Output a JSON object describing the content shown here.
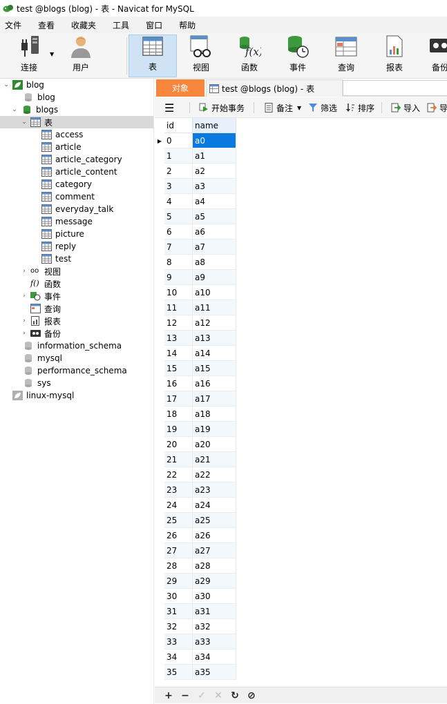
{
  "window": {
    "title": "test @blogs (blog) - 表 - Navicat for MySQL"
  },
  "menubar": {
    "items": [
      "文件",
      "查看",
      "收藏夹",
      "工具",
      "窗口",
      "帮助"
    ]
  },
  "toolbar": {
    "connect": "连接",
    "user": "用户",
    "table": "表",
    "view": "视图",
    "function": "函数",
    "event": "事件",
    "query": "查询",
    "report": "报表",
    "backup": "备份"
  },
  "tree": {
    "conn_blog": "blog",
    "db_blog": "blog",
    "db_blogs": "blogs",
    "node_tables": "表",
    "tables": [
      "access",
      "article",
      "article_category",
      "article_content",
      "category",
      "comment",
      "everyday_talk",
      "message",
      "picture",
      "reply",
      "test"
    ],
    "node_views": "视图",
    "node_functions": "函数",
    "node_events": "事件",
    "node_queries": "查询",
    "node_reports": "报表",
    "node_backups": "备份",
    "db_info": "information_schema",
    "db_mysql": "mysql",
    "db_perf": "performance_schema",
    "db_sys": "sys",
    "conn_linux": "linux-mysql"
  },
  "tabs": {
    "objects": "对象",
    "doc": "test @blogs (blog) - 表"
  },
  "subtoolbar": {
    "begin_transaction": "开始事务",
    "memo": "备注",
    "filter": "筛选",
    "sort": "排序",
    "import": "导入",
    "export": "导"
  },
  "grid": {
    "columns": [
      "id",
      "name"
    ],
    "rows": [
      [
        "0",
        "a0"
      ],
      [
        "1",
        "a1"
      ],
      [
        "2",
        "a2"
      ],
      [
        "3",
        "a3"
      ],
      [
        "4",
        "a4"
      ],
      [
        "5",
        "a5"
      ],
      [
        "6",
        "a6"
      ],
      [
        "7",
        "a7"
      ],
      [
        "8",
        "a8"
      ],
      [
        "9",
        "a9"
      ],
      [
        "10",
        "a10"
      ],
      [
        "11",
        "a11"
      ],
      [
        "12",
        "a12"
      ],
      [
        "13",
        "a13"
      ],
      [
        "14",
        "a14"
      ],
      [
        "15",
        "a15"
      ],
      [
        "16",
        "a16"
      ],
      [
        "17",
        "a17"
      ],
      [
        "18",
        "a18"
      ],
      [
        "19",
        "a19"
      ],
      [
        "20",
        "a20"
      ],
      [
        "21",
        "a21"
      ],
      [
        "22",
        "a22"
      ],
      [
        "23",
        "a23"
      ],
      [
        "24",
        "a24"
      ],
      [
        "25",
        "a25"
      ],
      [
        "26",
        "a26"
      ],
      [
        "27",
        "a27"
      ],
      [
        "28",
        "a28"
      ],
      [
        "29",
        "a29"
      ],
      [
        "30",
        "a30"
      ],
      [
        "31",
        "a31"
      ],
      [
        "32",
        "a32"
      ],
      [
        "33",
        "a33"
      ],
      [
        "34",
        "a34"
      ],
      [
        "35",
        "a35"
      ]
    ]
  },
  "bottombar": {
    "add": "+",
    "remove": "−",
    "apply": "✓",
    "discard": "✕",
    "refresh": "↻",
    "stop": "⊘"
  },
  "colors": {
    "accent_orange": "#f5863b",
    "selection_blue": "#0a7ae0",
    "db_green": "#3c9a3c"
  }
}
